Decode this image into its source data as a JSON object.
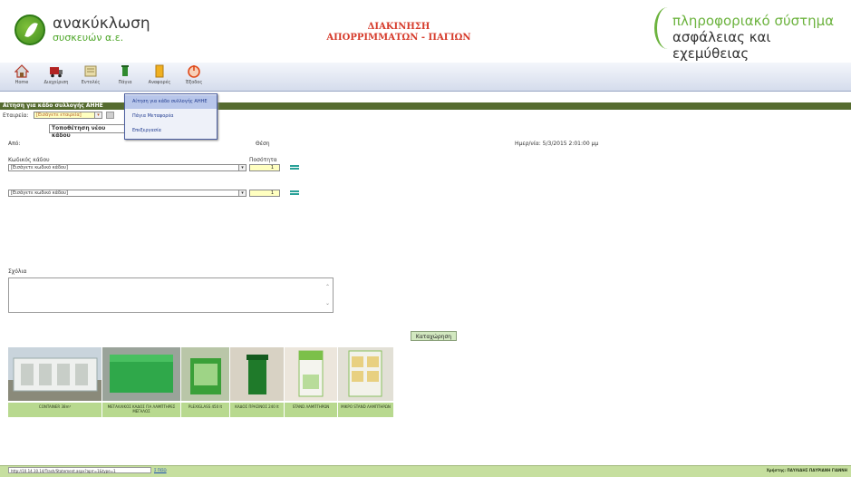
{
  "header": {
    "logo_name": "ανακύκλωση",
    "logo_sub": "συσκευών α.ε.",
    "title_line1": "ΔΙΑΚΙΝΗΣΗ",
    "title_line2": "ΑΠΟΡΡΙΜΜΑΤΩΝ - ΠΑΓΙΩΝ",
    "right_line1": "πληροφοριακό σύστημα",
    "right_line2": "ασφάλειας και εχεμύθειας"
  },
  "toolbar": [
    {
      "label": "Home",
      "icon": "home-icon"
    },
    {
      "label": "Διαχείριση",
      "icon": "truck-icon"
    },
    {
      "label": "Εντολές",
      "icon": "orders-icon"
    },
    {
      "label": "Πάγια",
      "icon": "bin-icon"
    },
    {
      "label": "Αναφορές",
      "icon": "reports-icon"
    },
    {
      "label": "Έξοδος",
      "icon": "power-icon"
    }
  ],
  "menu": [
    "Αίτηση για κάδο συλλογής ΑΗΗΕ",
    "Πάγια Μεταφορέα",
    "Επεξεργασία"
  ],
  "section_title": "Αίτηση για κάδο συλλογής ΑΗΗΕ",
  "form": {
    "company_label": "Εταιρεία:",
    "company_value": "[Εισάγετε εταιρεία]",
    "action_value": "Τοποθέτηση νέου κάδου",
    "from_label": "Από:",
    "position_label": "Θέση",
    "datetime": "Ημερ/νία: 5/3/2015 2:01:00 μμ",
    "bin_code_label": "Κωδικός κάδου",
    "quantity_label": "Ποσότητα",
    "bin_code_value_1": "[Εισάγετε κωδικό κάδου]",
    "bin_code_value_2": "[Εισάγετε κωδικό κάδου]",
    "qty_1": "1",
    "qty_2": "1",
    "comments_label": "Σχόλια",
    "save_label": "Καταχώρηση"
  },
  "products": [
    {
      "name": "CONTAINER 38m³"
    },
    {
      "name": "ΜΕΤΑΛΛΙΚΟΣ ΚΑΔΟΣ ΓΙΑ ΛΑΜΠΤΗΡΕΣ ΜΕΓΑΛΟΣ"
    },
    {
      "name": "PLEXIGLASS 450 lt"
    },
    {
      "name": "ΚΑΔΟΣ ΠΡΑΣΙΝΟΣ 240 lt"
    },
    {
      "name": "STAND ΛΑΜΠΤΗΡΩΝ"
    },
    {
      "name": "ΜΙΚΡΟ STAND ΛΑΜΠΤΗΡΩΝ"
    }
  ],
  "footer": {
    "url": "http://10.14.10.14/Trash/Statement.aspx?aprr=1&type=1",
    "link": "Σ ΠΙΣΩ",
    "user": "Χρήστης: ΠΑΥΛΙΔΗΣ ΠΑΥΡΙΑΝΗ ΓΙΑΝΝΗ"
  },
  "colors": {
    "section_bar": "#556b2f",
    "title_red": "#d63b2b",
    "brand_green": "#6cb33e",
    "caption_green": "#b8d98f"
  }
}
